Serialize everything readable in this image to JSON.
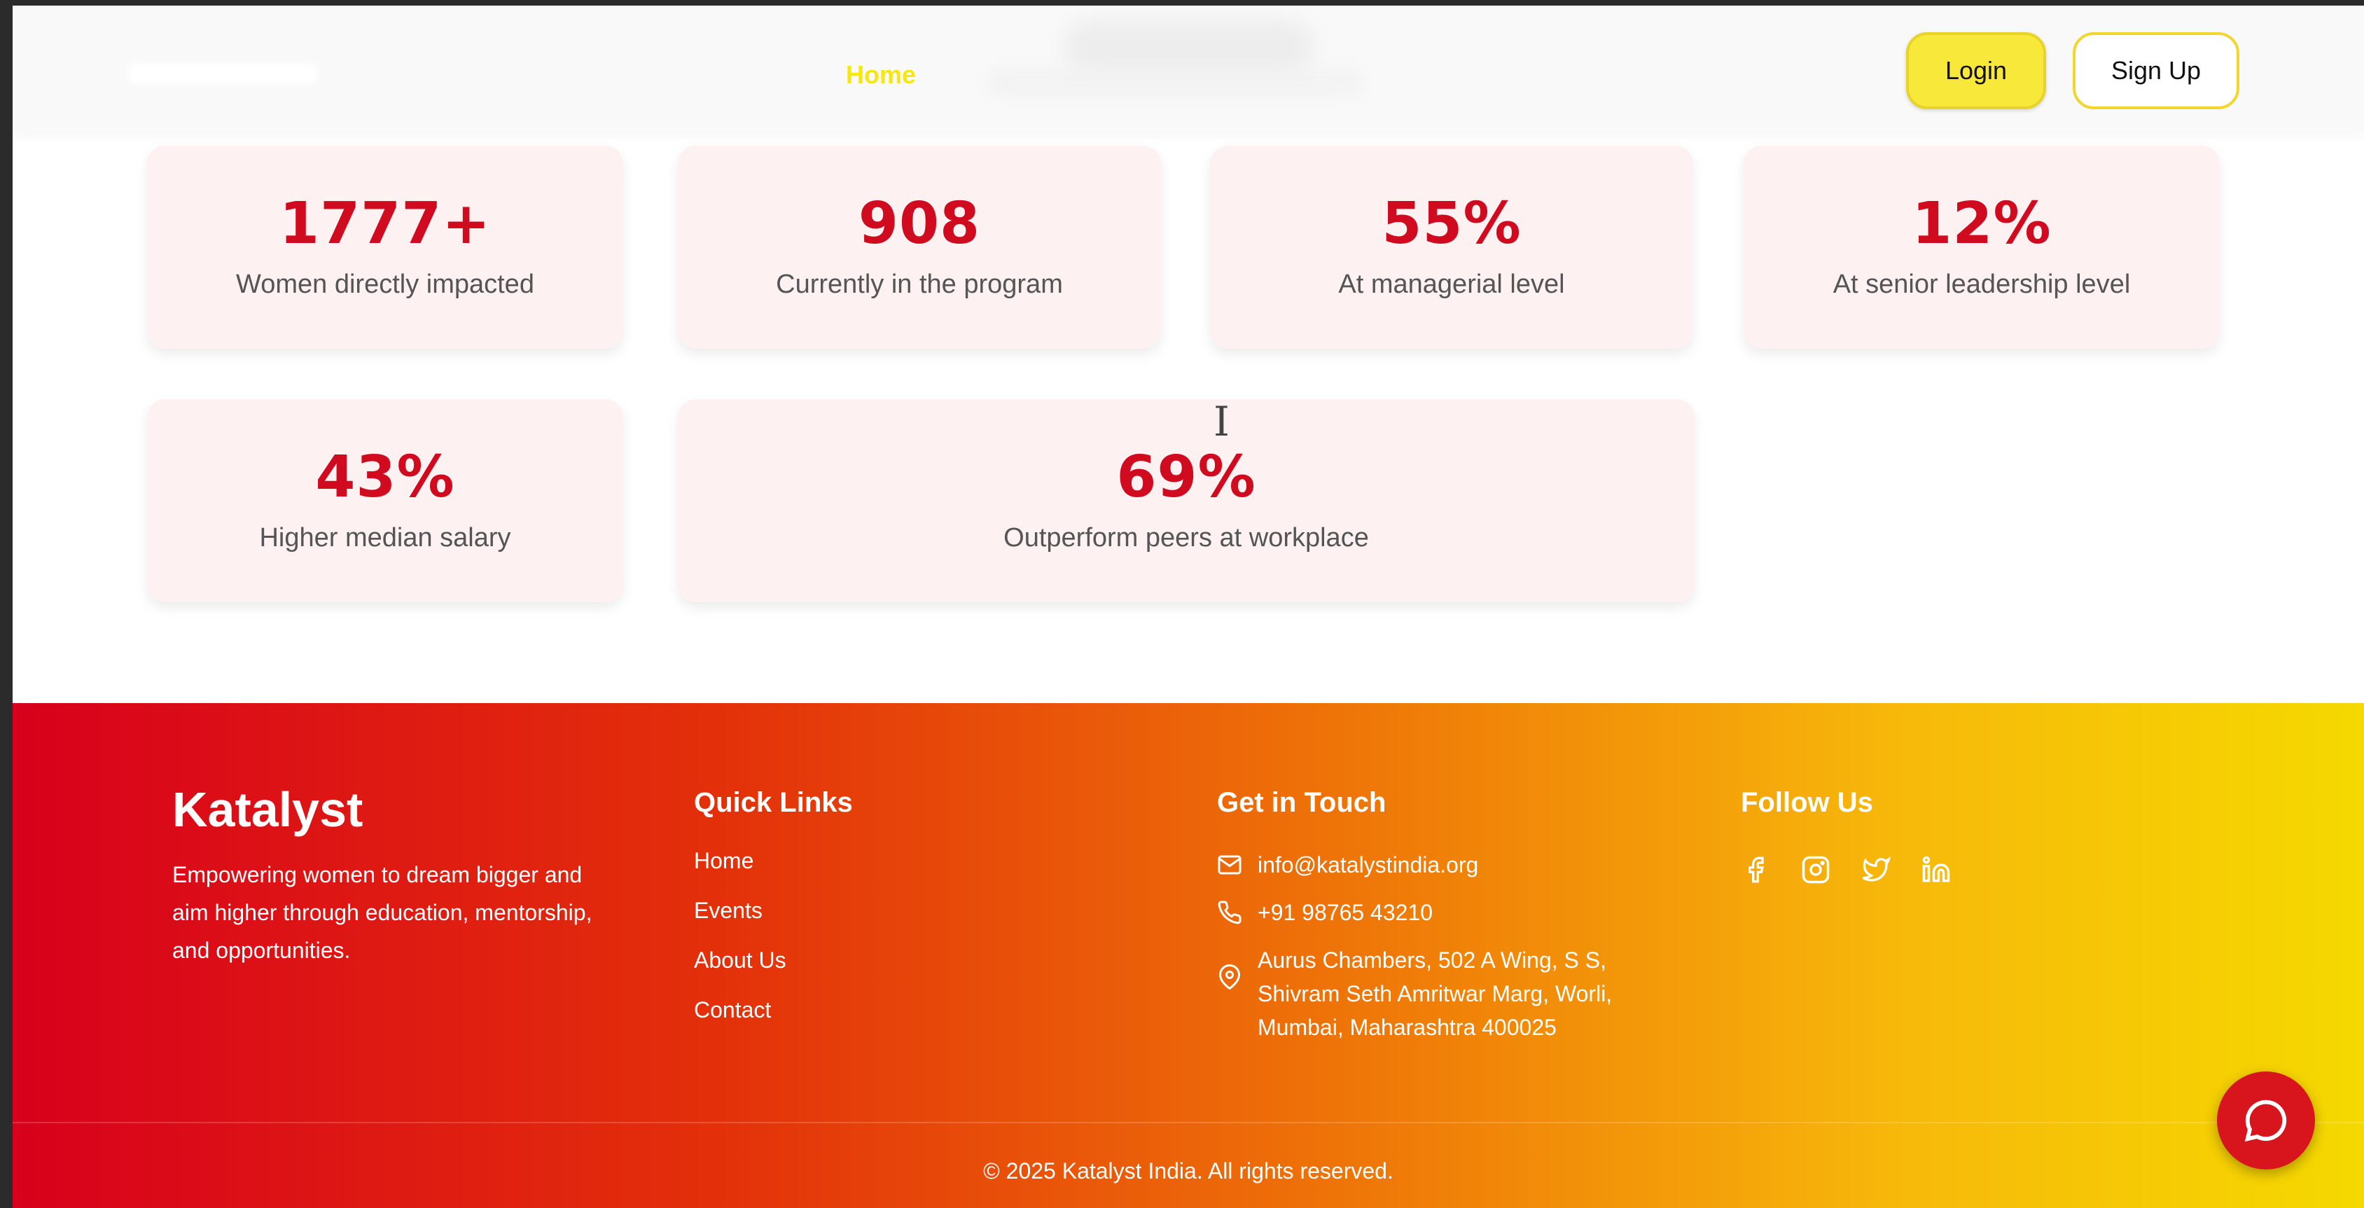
{
  "header": {
    "nav_home": "Home",
    "login_label": "Login",
    "signup_label": "Sign Up"
  },
  "stats": [
    {
      "value": "1777+",
      "label": "Women directly impacted"
    },
    {
      "value": "908",
      "label": "Currently in the program"
    },
    {
      "value": "55%",
      "label": "At managerial level"
    },
    {
      "value": "12%",
      "label": "At senior leadership level"
    },
    {
      "value": "43%",
      "label": "Higher median salary"
    },
    {
      "value": "69%",
      "label": "Outperform peers at workplace"
    }
  ],
  "footer": {
    "brand": "Katalyst",
    "description": "Empowering women to dream bigger and aim higher through education, mentorship, and opportunities.",
    "quick_links_title": "Quick Links",
    "quick_links": [
      "Home",
      "Events",
      "About Us",
      "Contact"
    ],
    "contact_title": "Get in Touch",
    "email": "info@katalystindia.org",
    "phone": "+91 98765 43210",
    "address": "Aurus Chambers, 502 A Wing, S S, Shivram Seth Amritwar Marg, Worli, Mumbai, Maharashtra 400025",
    "follow_title": "Follow Us",
    "social_icons": [
      "facebook-icon",
      "instagram-icon",
      "twitter-icon",
      "linkedin-icon"
    ],
    "copyright": "© 2025 Katalyst India. All rights reserved."
  },
  "colors": {
    "accent_red": "#d00a1f",
    "accent_yellow": "#f7e83a",
    "footer_gradient_start": "#d8001c",
    "footer_gradient_end": "#f5d900"
  }
}
